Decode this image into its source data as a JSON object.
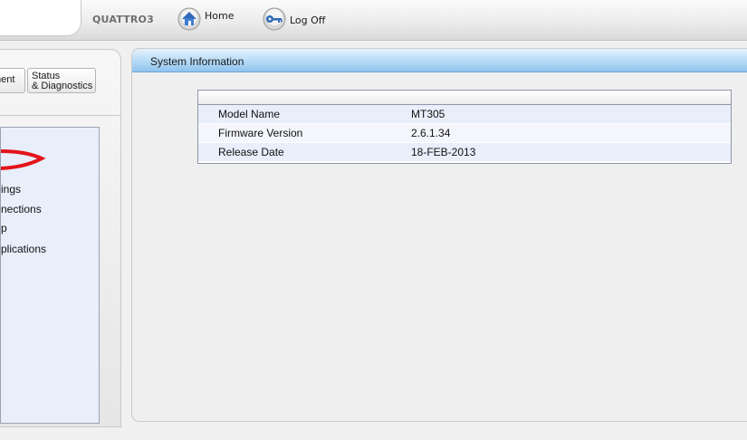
{
  "header": {
    "device_name": "QUATTRO3",
    "home_label": "Home",
    "logoff_label": "Log Off",
    "home_icon": "home-icon",
    "logoff_icon": "key-icon"
  },
  "sidebar": {
    "tabs": [
      {
        "label": "ment"
      },
      {
        "label": "Status\n& Diagnostics"
      }
    ],
    "items": [
      {
        "label": "ings"
      },
      {
        "label": "nections"
      },
      {
        "label": "p"
      },
      {
        "label": "plications"
      }
    ]
  },
  "main": {
    "title": "System Information",
    "rows": [
      {
        "key": "Model Name",
        "value": "MT305"
      },
      {
        "key": "Firmware Version",
        "value": "2.6.1.34"
      },
      {
        "key": "Release Date",
        "value": "18-FEB-2013"
      }
    ]
  },
  "colors": {
    "header_blue": "#8fc3ee",
    "nav_background": "#e8eefa",
    "brand_red": "#e4141b"
  }
}
